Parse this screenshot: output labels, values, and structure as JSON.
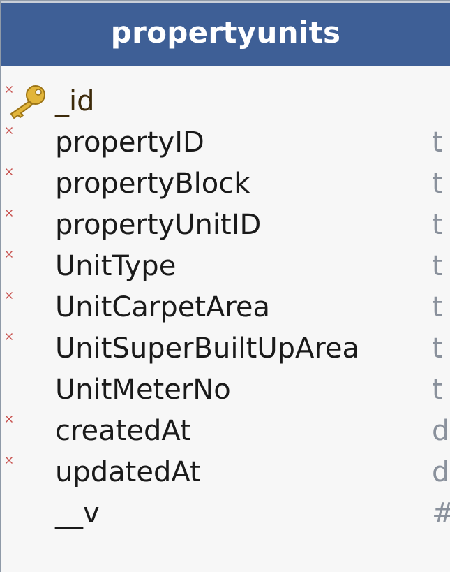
{
  "table": {
    "title": "propertyunits",
    "fields": [
      {
        "name": "_id",
        "type": "",
        "required": true,
        "primary_key": true
      },
      {
        "name": "propertyID",
        "type": "t",
        "required": true,
        "primary_key": false
      },
      {
        "name": "propertyBlock",
        "type": "t",
        "required": true,
        "primary_key": false
      },
      {
        "name": "propertyUnitID",
        "type": "t",
        "required": true,
        "primary_key": false
      },
      {
        "name": "UnitType",
        "type": "t",
        "required": true,
        "primary_key": false
      },
      {
        "name": "UnitCarpetArea",
        "type": "t",
        "required": true,
        "primary_key": false
      },
      {
        "name": "UnitSuperBuiltUpArea",
        "type": "t",
        "required": true,
        "primary_key": false
      },
      {
        "name": "UnitMeterNo",
        "type": "t",
        "required": false,
        "primary_key": false
      },
      {
        "name": "createdAt",
        "type": "d",
        "required": true,
        "primary_key": false
      },
      {
        "name": "updatedAt",
        "type": "d",
        "required": true,
        "primary_key": false
      },
      {
        "name": "__v",
        "type": "#",
        "required": false,
        "primary_key": false
      }
    ]
  },
  "colors": {
    "header": "#3e5f96",
    "background": "#f7f7f7",
    "required_marker": "#c8524f",
    "type_text": "#8a919c",
    "key_icon": "#e2b53a"
  },
  "icons": {
    "primary_key": "key-icon",
    "required": "required-marker-icon"
  }
}
